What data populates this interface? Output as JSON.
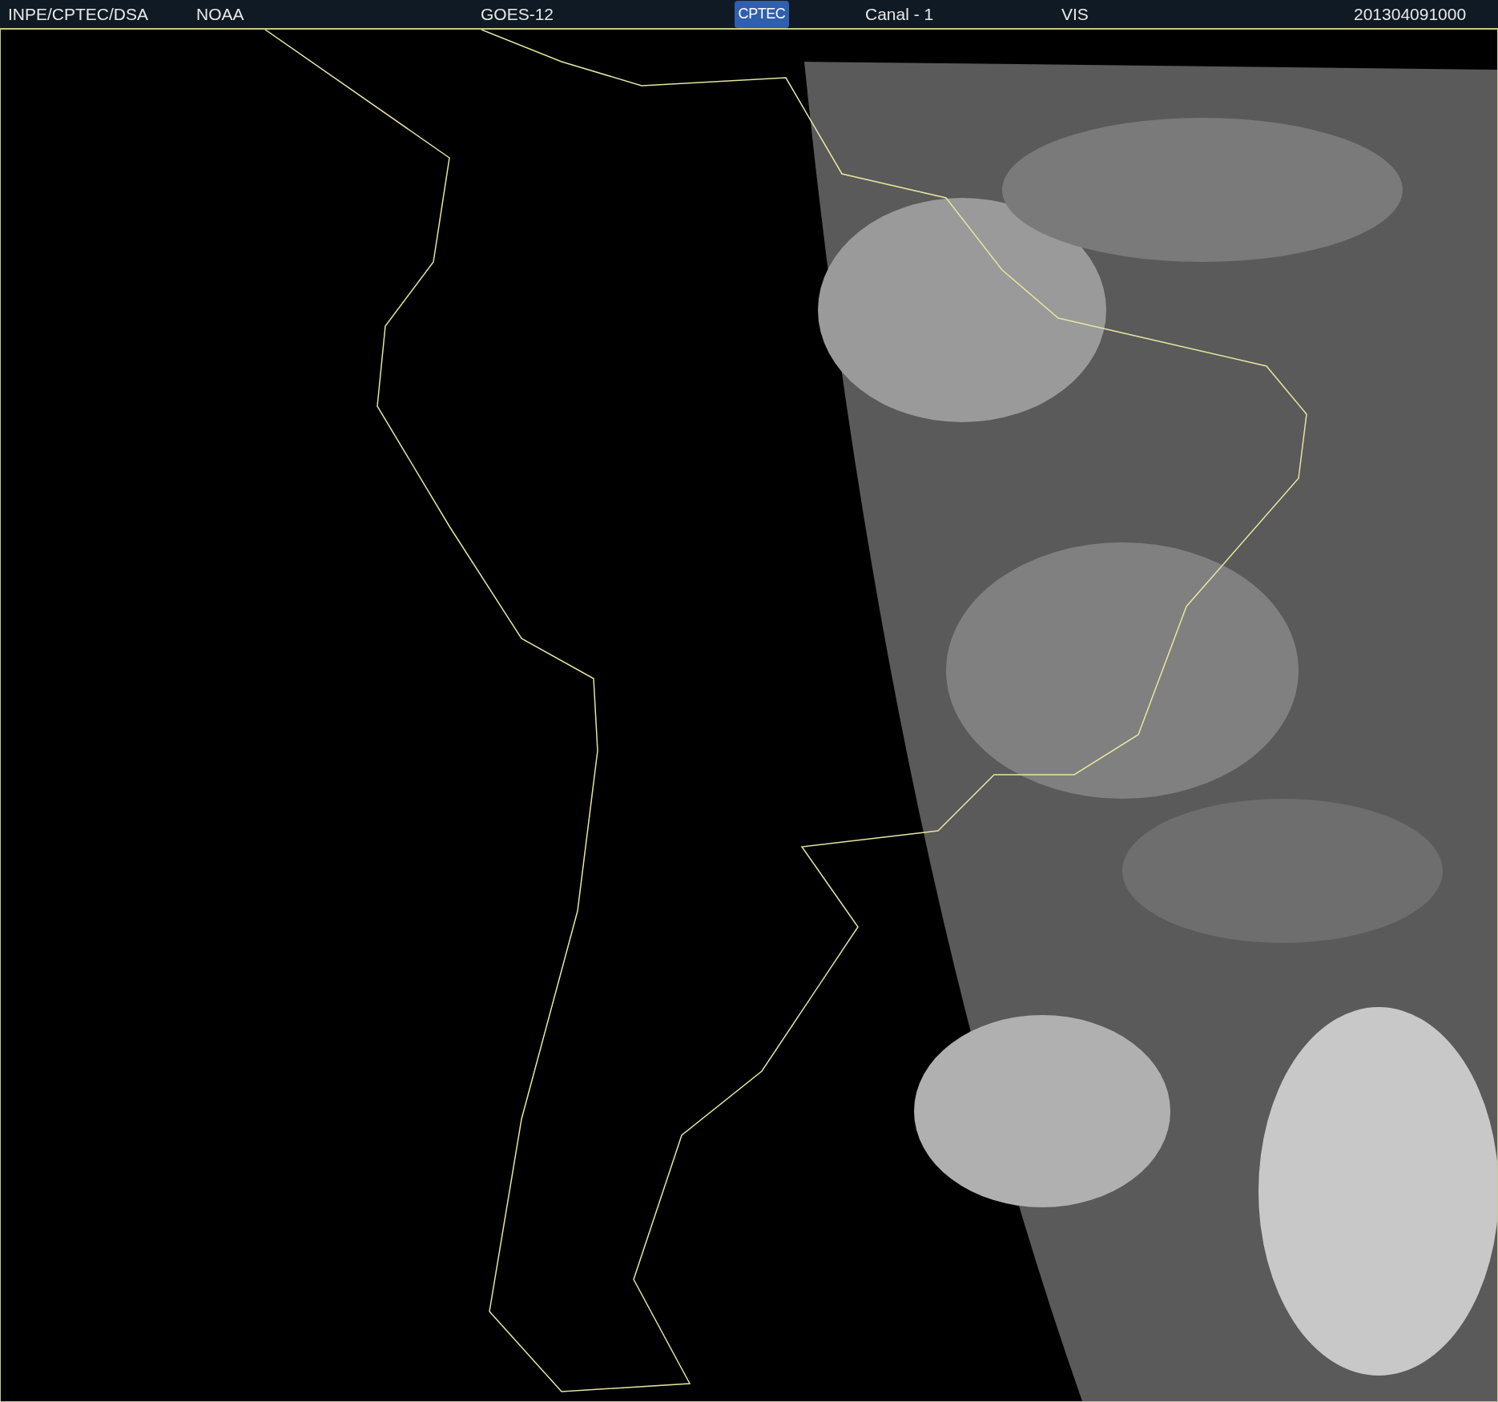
{
  "header": {
    "items": [
      {
        "kind": "text",
        "text": "INPE/CPTEC/DSA"
      },
      {
        "kind": "text",
        "text": "NOAA"
      },
      {
        "kind": "text",
        "text": "GOES-12"
      },
      {
        "kind": "logo",
        "text": "CPTEC"
      },
      {
        "kind": "text",
        "text": "Canal - 1"
      },
      {
        "kind": "text",
        "text": "VIS"
      },
      {
        "kind": "text",
        "text": "201304091000"
      }
    ]
  }
}
